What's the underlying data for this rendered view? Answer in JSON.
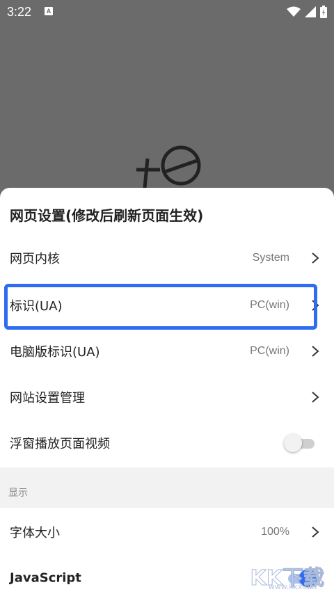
{
  "status_bar": {
    "time": "3:22",
    "notification_icon": "A"
  },
  "sheet": {
    "title": "网页设置(修改后刷新页面生效)",
    "rows": [
      {
        "label": "网页内核",
        "value": "System"
      },
      {
        "label": "标识(UA)",
        "value": "PC(win)"
      },
      {
        "label": "电脑版标识(UA)",
        "value": "PC(win)"
      },
      {
        "label": "网站设置管理",
        "value": ""
      },
      {
        "label": "浮窗播放页面视频",
        "toggle": false
      }
    ],
    "section_display": {
      "label": "显示",
      "rows": [
        {
          "label": "字体大小",
          "value": "100%"
        },
        {
          "label": "JavaScript",
          "toggle": true
        }
      ]
    }
  },
  "watermark": {
    "text": "KK下载",
    "url": "www.kkx.net"
  },
  "colors": {
    "accent": "#2f6cf2",
    "overlay": "#6b6b6b"
  }
}
